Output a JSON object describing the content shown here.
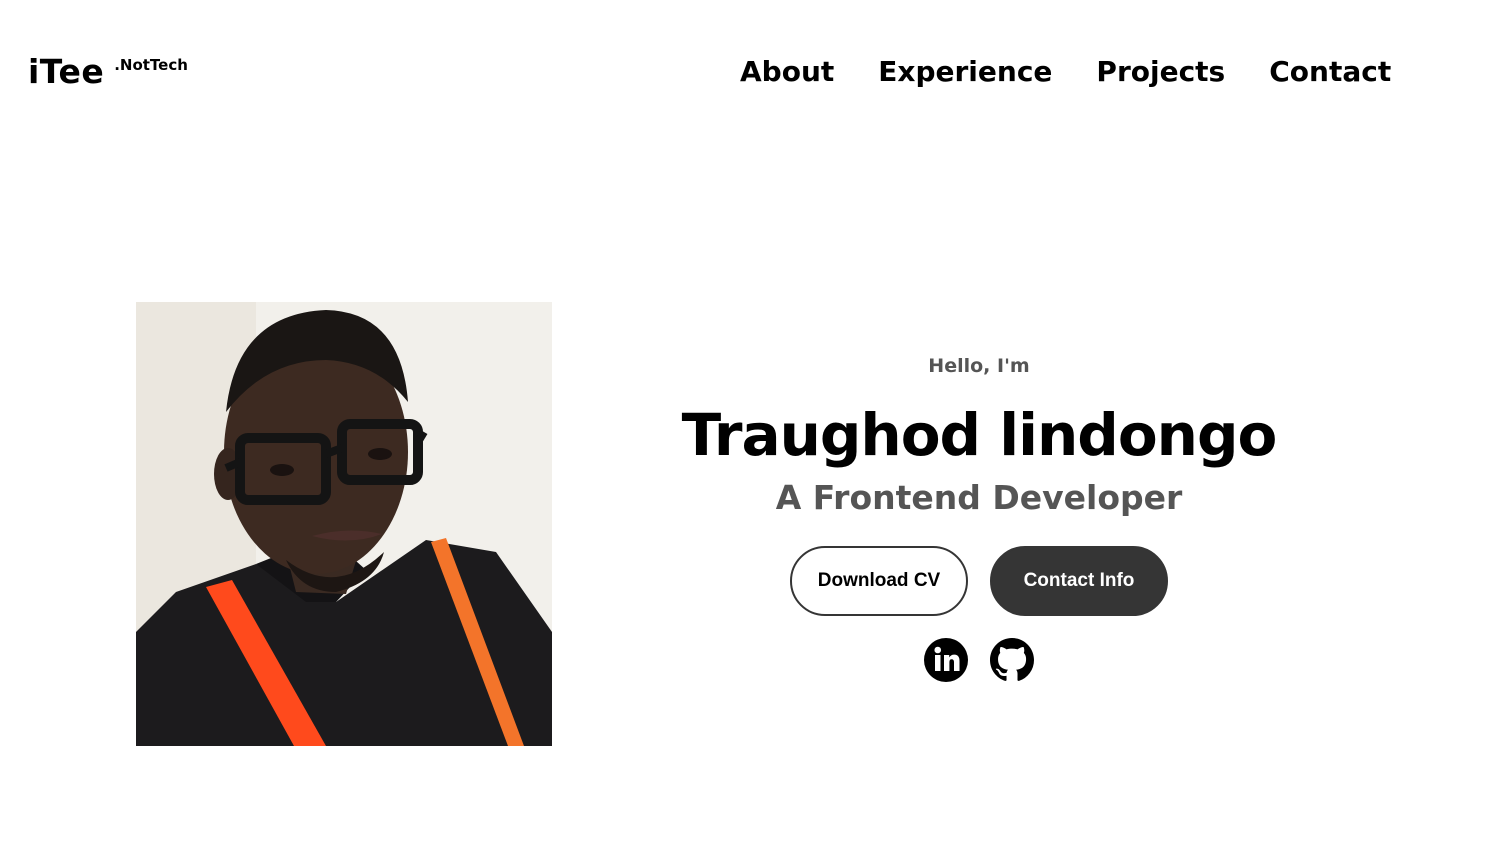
{
  "header": {
    "logo": {
      "main": "iTee",
      "sup": ".NotTech"
    },
    "nav": [
      {
        "label": "About"
      },
      {
        "label": "Experience"
      },
      {
        "label": "Projects"
      },
      {
        "label": "Contact"
      }
    ]
  },
  "hero": {
    "greeting": "Hello, I'm",
    "name": "Traughod lindongo",
    "role": "A Frontend Developer",
    "buttons": {
      "download": "Download CV",
      "contact": "Contact Info"
    },
    "socials": [
      {
        "icon": "linkedin-icon"
      },
      {
        "icon": "github-icon"
      }
    ]
  },
  "colors": {
    "text": "#000000",
    "muted": "#555555",
    "button_dark": "#353535",
    "suspender": "#ff5a1f"
  }
}
